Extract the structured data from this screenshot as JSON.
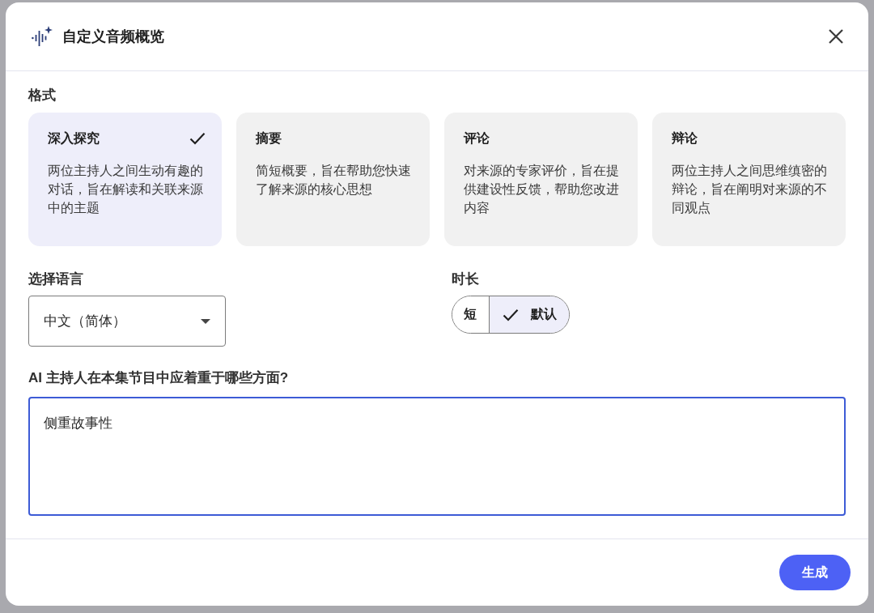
{
  "dialog": {
    "title": "自定义音频概览"
  },
  "format": {
    "label": "格式",
    "options": [
      {
        "title": "深入探究",
        "description": "两位主持人之间生动有趣的对话，旨在解读和关联来源中的主题",
        "selected": true
      },
      {
        "title": "摘要",
        "description": "简短概要，旨在帮助您快速了解来源的核心思想",
        "selected": false
      },
      {
        "title": "评论",
        "description": "对来源的专家评价，旨在提供建设性反馈，帮助您改进内容",
        "selected": false
      },
      {
        "title": "辩论",
        "description": "两位主持人之间思维缜密的辩论，旨在阐明对来源的不同观点",
        "selected": false
      }
    ]
  },
  "language": {
    "label": "选择语言",
    "value": "中文（简体）"
  },
  "duration": {
    "label": "时长",
    "options": [
      {
        "label": "短",
        "selected": false
      },
      {
        "label": "默认",
        "selected": true
      }
    ]
  },
  "focus": {
    "label": "AI 主持人在本集节目中应着重于哪些方面?",
    "value": "侧重故事性"
  },
  "buttons": [
    "生成"
  ]
}
